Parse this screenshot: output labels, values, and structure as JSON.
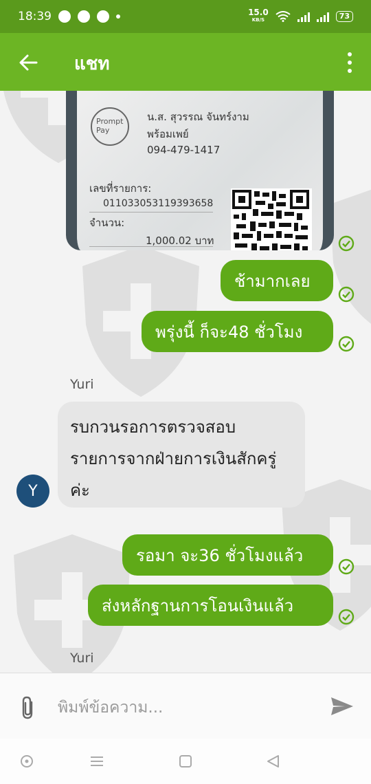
{
  "status_bar": {
    "time": "18:39",
    "net_speed_value": "15.0",
    "net_speed_unit": "KB/S",
    "battery": "73"
  },
  "app_bar": {
    "title": "แชท"
  },
  "slip": {
    "logo_line1": "Prompt",
    "logo_line2": "Pay",
    "name": "น.ส. สุวรรณ จันทร์งาม",
    "service": "พร้อมเพย์",
    "phone": "094-479-1417",
    "ref_label": "เลขที่รายการ:",
    "ref_number": "011033053119393658",
    "amount_label": "จำนวน:",
    "amount": "1,000.02 บาท"
  },
  "messages": [
    {
      "direction": "out",
      "text": "ช้ามากเลย"
    },
    {
      "direction": "out",
      "text": "พรุ่งนี้ ก็จะ48 ชั่วโมง"
    },
    {
      "direction": "in",
      "sender": "Yuri",
      "avatar_letter": "Y",
      "text": "รบกวนรอการตรวจสอบ รายการจากฝ่ายการเงินสักครู่ค่ะ"
    },
    {
      "direction": "out",
      "text": "รอมา จะ36 ชั่วโมงแล้ว"
    },
    {
      "direction": "out",
      "text": "ส่งหลักฐานการโอนเงินแล้ว"
    },
    {
      "direction": "in",
      "sender": "Yuri"
    }
  ],
  "composer": {
    "placeholder": "พิมพ์ข้อความ..."
  },
  "colors": {
    "status_bar": "#5a9a1c",
    "app_bar": "#6cb524",
    "bubble_out": "#5faa18",
    "bubble_in": "#e6e6e6",
    "avatar": "#1e4f7a",
    "check": "#5faa18"
  }
}
